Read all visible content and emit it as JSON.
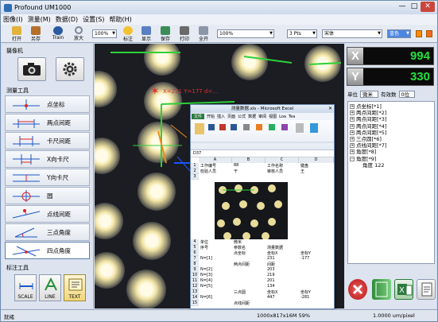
{
  "window": {
    "title": "Profound UM1000",
    "btn_min": "—",
    "btn_max": "□",
    "btn_close": "✕"
  },
  "menu": [
    "图像(I)",
    "测量(M)",
    "数据(D)",
    "设置(S)",
    "帮助(H)"
  ],
  "toolbar": {
    "buttons": [
      {
        "label": "打开",
        "icon": "open-icon",
        "color": "#e2b23a"
      },
      {
        "label": "另存",
        "icon": "save-icon",
        "color": "#b5702b"
      },
      {
        "label": "Train",
        "icon": "train-icon",
        "color": "#2c5aa0"
      },
      {
        "label": "放大",
        "icon": "zoom-icon",
        "color": "#7a8799"
      }
    ],
    "zoom_value": "100%",
    "buttons2": [
      {
        "label": "标注",
        "icon": "annotate-icon",
        "color": "#f2c230"
      },
      {
        "label": "显示",
        "icon": "display-icon",
        "color": "#5a7fc2"
      },
      {
        "label": "保存",
        "icon": "save-image-icon",
        "color": "#3c8c5a"
      },
      {
        "label": "打印",
        "icon": "print-icon",
        "color": "#6a6a6a"
      },
      {
        "label": "全开",
        "icon": "fullscreen-icon",
        "color": "#8b96a8"
      }
    ],
    "color_value": "100%",
    "line_width_value": "3 Pts",
    "font_value": "宋体",
    "font_color_value": "蓝色",
    "accent_colors": [
      "#ff8c00",
      "#f06b1e"
    ]
  },
  "left": {
    "camera_title": "摄像机",
    "tools_title": "测量工具",
    "tools": [
      "点坐标",
      "两点间距",
      "卡尺间距",
      "X向卡尺",
      "Y向卡尺",
      "圆",
      "点线间距",
      "三点角度",
      "四点角度"
    ],
    "annotation_title": "标注工具",
    "annotation_buttons": [
      "SCALE",
      "LINE",
      "TEXT"
    ]
  },
  "overlay": {
    "point_label": "X=231 Y=177 d=…"
  },
  "excel": {
    "title": "测量数据.xls - Microsoft Excel",
    "tabs": [
      "文件",
      "开始",
      "插入",
      "页面",
      "公式",
      "数据",
      "审阅",
      "视图",
      "Loa",
      "Tea"
    ],
    "cell_ref": "D37",
    "col_headers": [
      "A",
      "B",
      "C",
      "D"
    ],
    "rows": [
      [
        "工作编号",
        "88",
        "工作名称",
        "键盘"
      ],
      [
        "检验人员",
        "干",
        "审核人员",
        "王"
      ],
      [
        "",
        "",
        "",
        ""
      ],
      [
        "单位",
        "微米",
        "",
        ""
      ],
      [
        "序号",
        "参数名",
        "测量数据",
        ""
      ],
      [
        "",
        "点坐标",
        "坐标X",
        "坐标Y"
      ],
      [
        "N=[1]",
        "",
        "231",
        "-177"
      ],
      [
        "",
        "两点间距",
        "间距",
        ""
      ],
      [
        "N=[2]",
        "",
        "203",
        ""
      ],
      [
        "N=[3]",
        "",
        "219",
        ""
      ],
      [
        "N=[4]",
        "",
        "201",
        ""
      ],
      [
        "N=[5]",
        "",
        "134",
        ""
      ],
      [
        "",
        "三点圆",
        "坐标X",
        "坐标Y"
      ],
      [
        "N=[6]",
        "",
        "447",
        "-281"
      ],
      [
        "",
        "点线间距",
        "",
        ""
      ]
    ]
  },
  "coords": {
    "x_label": "X",
    "x_value": "994",
    "y_label": "Y",
    "y_value": "330"
  },
  "units": {
    "label": "单位",
    "value": "微米",
    "digits_label": "有效数",
    "digits_value": "0位"
  },
  "tree": [
    {
      "text": "点坐标[*1]",
      "expanded": false
    },
    {
      "text": "两点间距[*2]",
      "expanded": false
    },
    {
      "text": "两点间距[*3]",
      "expanded": false
    },
    {
      "text": "两点间距[*4]",
      "expanded": false
    },
    {
      "text": "两点间距[*5]",
      "expanded": false
    },
    {
      "text": "三点圆[*6]",
      "expanded": false
    },
    {
      "text": "点线间距[*7]",
      "expanded": false
    },
    {
      "text": "角度[*8]",
      "expanded": false
    },
    {
      "text": "角度[*9]",
      "expanded": true
    },
    {
      "text": "角度  122",
      "child": true
    }
  ],
  "status": {
    "left": "就绪",
    "middle": "1000x817x16M 59%",
    "right": "1.0000 um/pixel"
  }
}
